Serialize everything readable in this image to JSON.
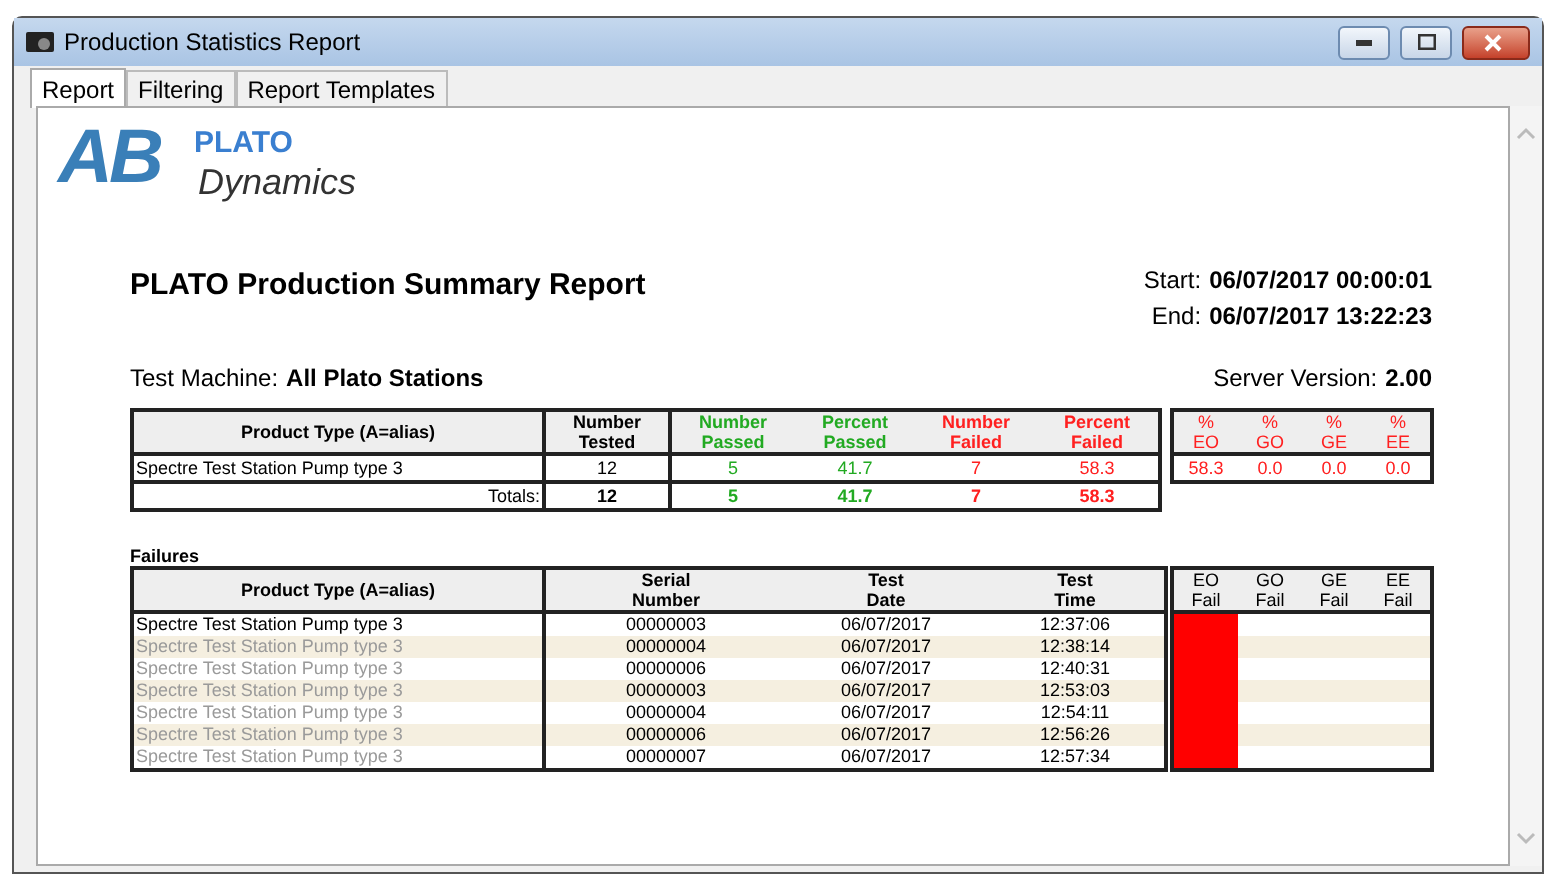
{
  "window": {
    "title": "Production Statistics Report"
  },
  "tabs": [
    {
      "label": "Report",
      "selected": true
    },
    {
      "label": "Filtering",
      "selected": false
    },
    {
      "label": "Report Templates",
      "selected": false
    }
  ],
  "report": {
    "logo": {
      "letters": "AB",
      "brand": "PLATO",
      "sub": "Dynamics"
    },
    "title": "PLATO Production Summary Report",
    "start_label": "Start:",
    "start": "06/07/2017 00:00:01",
    "end_label": "End:",
    "end": "06/07/2017 13:22:23",
    "machine_label": "Test Machine:",
    "machine": "All Plato Stations",
    "server_label": "Server Version:",
    "server": "2.00"
  },
  "summary": {
    "columns": [
      {
        "label": "Product Type (A=alias)",
        "color": "#000000"
      },
      {
        "label": "Number\nTested",
        "color": "#000000"
      },
      {
        "label": "Number\nPassed",
        "color": "#22aa22"
      },
      {
        "label": "Percent\nPassed",
        "color": "#22aa22"
      },
      {
        "label": "Number\nFailed",
        "color": "#ff2020"
      },
      {
        "label": "Percent\nFailed",
        "color": "#ff2020"
      }
    ],
    "rows": [
      {
        "cells": [
          "Spectre Test Station Pump type 3",
          "12",
          "5",
          "41.7",
          "7",
          "58.3"
        ]
      }
    ],
    "totals": {
      "label": "Totals:",
      "cells": [
        "12",
        "5",
        "41.7",
        "7",
        "58.3"
      ]
    },
    "modes": {
      "columns": [
        "%\nEO",
        "%\nGO",
        "%\nGE",
        "%\nEE"
      ],
      "values": [
        "58.3",
        "0.0",
        "0.0",
        "0.0"
      ]
    }
  },
  "failures": {
    "title": "Failures",
    "columns": [
      "Product Type (A=alias)",
      "Serial\nNumber",
      "Test\nDate",
      "Test\nTime"
    ],
    "fail_columns": [
      "EO\nFail",
      "GO\nFail",
      "GE\nFail",
      "EE\nFail"
    ],
    "rows": [
      {
        "product": "Spectre Test Station Pump type 3",
        "repeated": false,
        "serial": "00000003",
        "date": "06/07/2017",
        "time": "12:37:06",
        "fails": {
          "eo": true,
          "go": false,
          "ge": false,
          "ee": false
        }
      },
      {
        "product": "Spectre Test Station Pump type 3",
        "repeated": true,
        "serial": "00000004",
        "date": "06/07/2017",
        "time": "12:38:14",
        "fails": {
          "eo": true,
          "go": false,
          "ge": false,
          "ee": false
        }
      },
      {
        "product": "Spectre Test Station Pump type 3",
        "repeated": true,
        "serial": "00000006",
        "date": "06/07/2017",
        "time": "12:40:31",
        "fails": {
          "eo": true,
          "go": false,
          "ge": false,
          "ee": false
        }
      },
      {
        "product": "Spectre Test Station Pump type 3",
        "repeated": true,
        "serial": "00000003",
        "date": "06/07/2017",
        "time": "12:53:03",
        "fails": {
          "eo": true,
          "go": false,
          "ge": false,
          "ee": false
        }
      },
      {
        "product": "Spectre Test Station Pump type 3",
        "repeated": true,
        "serial": "00000004",
        "date": "06/07/2017",
        "time": "12:54:11",
        "fails": {
          "eo": true,
          "go": false,
          "ge": false,
          "ee": false
        }
      },
      {
        "product": "Spectre Test Station Pump type 3",
        "repeated": true,
        "serial": "00000006",
        "date": "06/07/2017",
        "time": "12:56:26",
        "fails": {
          "eo": true,
          "go": false,
          "ge": false,
          "ee": false
        }
      },
      {
        "product": "Spectre Test Station Pump type 3",
        "repeated": true,
        "serial": "00000007",
        "date": "06/07/2017",
        "time": "12:57:34",
        "fails": {
          "eo": true,
          "go": false,
          "ge": false,
          "ee": false
        }
      }
    ]
  }
}
